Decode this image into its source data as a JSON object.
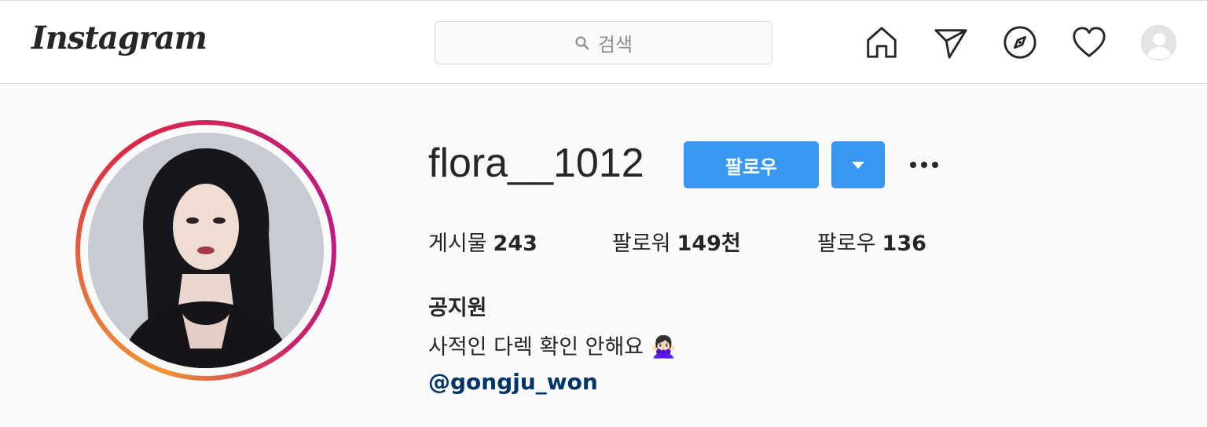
{
  "header": {
    "logo": "Instagram",
    "search_placeholder": "검색",
    "icons": [
      "home-icon",
      "direct-icon",
      "explore-icon",
      "activity-icon",
      "profile-avatar"
    ]
  },
  "profile": {
    "username": "flora__1012",
    "follow_label": "팔로우",
    "stats": {
      "posts_label": "게시물",
      "posts_value": "243",
      "followers_label": "팔로워",
      "followers_value": "149천",
      "following_label": "팔로우",
      "following_value": "136"
    },
    "full_name": "공지원",
    "bio": "사적인 다렉 확인 안해요 🙅🏻‍♀️",
    "link": "@gongju_won"
  },
  "colors": {
    "accent": "#3897f0",
    "link": "#003569",
    "text": "#262626",
    "background": "#fafafa"
  }
}
